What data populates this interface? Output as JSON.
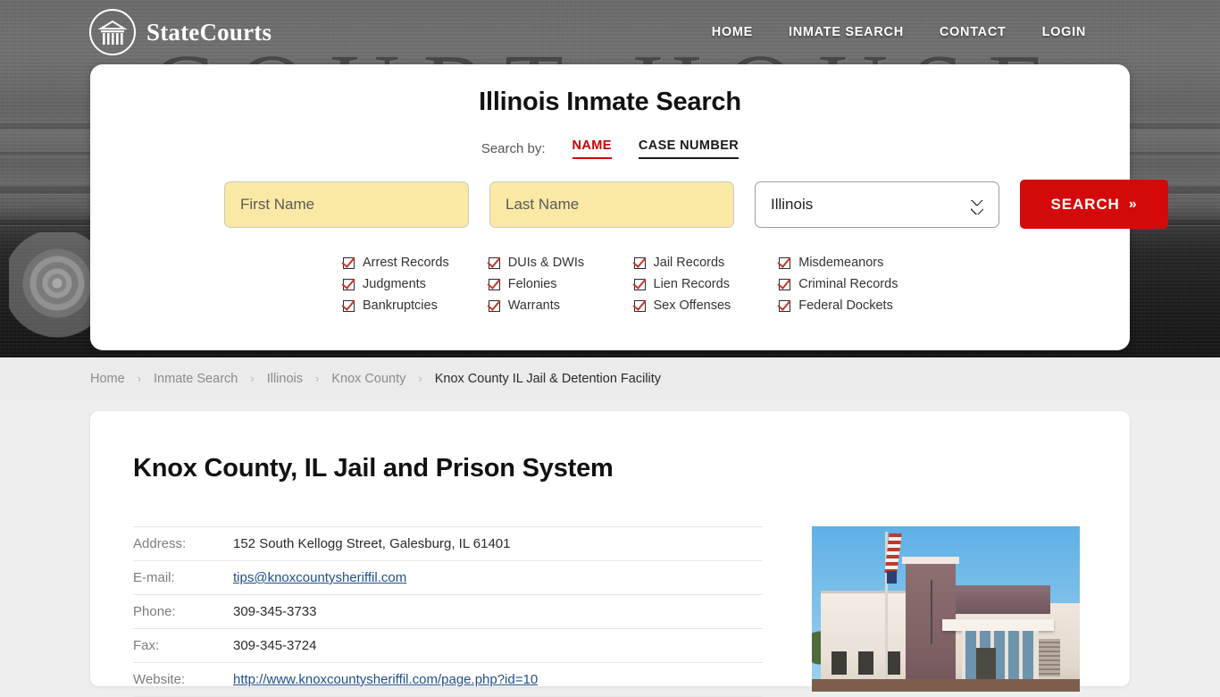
{
  "header": {
    "brand_name": "StateCourts",
    "logo_icon": "courthouse-circle-icon",
    "nav": [
      {
        "label": "HOME"
      },
      {
        "label": "INMATE SEARCH"
      },
      {
        "label": "CONTACT"
      },
      {
        "label": "LOGIN"
      }
    ]
  },
  "hero": {
    "background_word": "COURT HOUSE"
  },
  "search": {
    "title": "Illinois Inmate Search",
    "search_by_label": "Search by:",
    "tabs": [
      {
        "label": "NAME",
        "active": true
      },
      {
        "label": "CASE NUMBER",
        "active": false
      }
    ],
    "first_name_placeholder": "First Name",
    "first_name_value": "",
    "last_name_placeholder": "Last Name",
    "last_name_value": "",
    "state_selected": "Illinois",
    "state_options": [
      "Illinois"
    ],
    "submit_label": "SEARCH",
    "submit_chevron": "»",
    "record_types": [
      "Arrest Records",
      "DUIs & DWIs",
      "Jail Records",
      "Misdemeanors",
      "Judgments",
      "Felonies",
      "Lien Records",
      "Criminal Records",
      "Bankruptcies",
      "Warrants",
      "Sex Offenses",
      "Federal Dockets"
    ]
  },
  "breadcrumb": {
    "separator": "›",
    "items": [
      {
        "label": "Home",
        "current": false
      },
      {
        "label": "Inmate Search",
        "current": false
      },
      {
        "label": "Illinois",
        "current": false
      },
      {
        "label": "Knox County",
        "current": false
      },
      {
        "label": "Knox County IL Jail & Detention Facility",
        "current": true
      }
    ]
  },
  "facility": {
    "page_title": "Knox County, IL Jail and Prison System",
    "photo_alt": "knox-county-jail-building-photo",
    "details": [
      {
        "key": "Address:",
        "value": "152 South Kellogg Street, Galesburg, IL 61401",
        "link": false
      },
      {
        "key": "E-mail:",
        "value": "tips@knoxcountysheriffil.com",
        "link": true
      },
      {
        "key": "Phone:",
        "value": "309-345-3733",
        "link": false
      },
      {
        "key": "Fax:",
        "value": "309-345-3724",
        "link": false
      },
      {
        "key": "Website:",
        "value": "http://www.knoxcountysheriffil.com/page.php?id=10",
        "link": true
      }
    ]
  },
  "colors": {
    "accent_red": "#cc0000",
    "button_red": "#d40a0a",
    "input_yellow": "#fae9a4",
    "page_bg": "#eeeeee",
    "breadcrumb_bg": "#ebebeb",
    "link_blue": "#1f4f8b"
  }
}
